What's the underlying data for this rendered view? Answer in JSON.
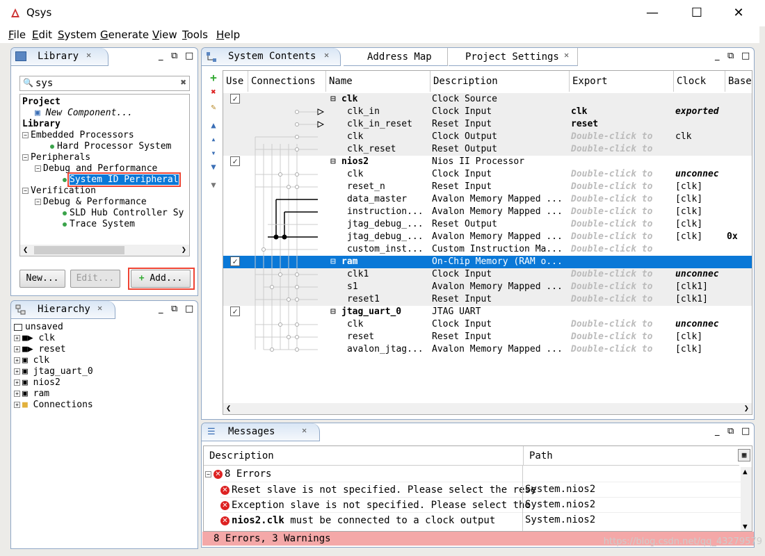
{
  "app": {
    "title": "Qsys"
  },
  "menu": [
    "File",
    "Edit",
    "System",
    "Generate",
    "View",
    "Tools",
    "Help"
  ],
  "library": {
    "tab": "Library",
    "search_value": "sys",
    "tree": [
      {
        "label": "Project",
        "bold": true,
        "indent": 0
      },
      {
        "label": "New Component...",
        "italic": true,
        "indent": 1,
        "icon": "component-icon"
      },
      {
        "label": "Library",
        "bold": true,
        "indent": 0
      },
      {
        "label": "Embedded Processors",
        "indent": 0,
        "expander": "−"
      },
      {
        "label": "Hard Processor System",
        "indent": 2,
        "dot": true
      },
      {
        "label": "Peripherals",
        "indent": 0,
        "expander": "−"
      },
      {
        "label": "Debug and Performance",
        "indent": 1,
        "expander": "−"
      },
      {
        "label": "System ID Peripheral",
        "indent": 3,
        "dot": true,
        "selected": true
      },
      {
        "label": "Verification",
        "indent": 0,
        "expander": "−"
      },
      {
        "label": "Debug & Performance",
        "indent": 1,
        "expander": "−"
      },
      {
        "label": "SLD Hub Controller Sy",
        "indent": 3,
        "dot": true
      },
      {
        "label": "Trace System",
        "indent": 3,
        "dot": true
      }
    ],
    "buttons": {
      "new": "New...",
      "edit": "Edit...",
      "add": "Add..."
    }
  },
  "hierarchy": {
    "tab": "Hierarchy",
    "root": "unsaved",
    "items": [
      "clk",
      "reset",
      "clk",
      "jtag_uart_0",
      "nios2",
      "ram",
      "Connections"
    ]
  },
  "tabs": {
    "system_contents": "System Contents",
    "address_map": "Address Map",
    "project_settings": "Project Settings"
  },
  "columns": {
    "use": "Use",
    "connections": "Connections",
    "name": "Name",
    "description": "Description",
    "export": "Export",
    "clock": "Clock",
    "base": "Base"
  },
  "rows": [
    {
      "use": true,
      "name": "clk",
      "bold": true,
      "desc": "Clock Source",
      "export": "",
      "clock": "",
      "group": "gray"
    },
    {
      "name": "clk_in",
      "desc": "Clock Input",
      "export": "clk",
      "export_bold": true,
      "clock": "exported",
      "clock_style": "bi",
      "group": "gray"
    },
    {
      "name": "clk_in_reset",
      "desc": "Reset Input",
      "export": "reset",
      "export_bold": true,
      "clock": "",
      "group": "gray"
    },
    {
      "name": "clk",
      "desc": "Clock Output",
      "export": "Double-click to",
      "clock": "clk",
      "group": "gray"
    },
    {
      "name": "clk_reset",
      "desc": "Reset Output",
      "export": "Double-click to",
      "clock": "",
      "group": "gray"
    },
    {
      "use": true,
      "name": "nios2",
      "bold": true,
      "desc": "Nios II Processor",
      "export": "",
      "clock": "",
      "group": "white"
    },
    {
      "name": "clk",
      "desc": "Clock Input",
      "export": "Double-click to",
      "clock": "unconnec",
      "clock_style": "bi",
      "group": "white"
    },
    {
      "name": "reset_n",
      "desc": "Reset Input",
      "export": "Double-click to",
      "clock": "[clk]",
      "group": "white"
    },
    {
      "name": "data_master",
      "desc": "Avalon Memory Mapped ...",
      "export": "Double-click to",
      "clock": "[clk]",
      "group": "white"
    },
    {
      "name": "instruction...",
      "desc": "Avalon Memory Mapped ...",
      "export": "Double-click to",
      "clock": "[clk]",
      "group": "white"
    },
    {
      "name": "jtag_debug_...",
      "desc": "Reset Output",
      "export": "Double-click to",
      "clock": "[clk]",
      "group": "white"
    },
    {
      "name": "jtag_debug_...",
      "desc": "Avalon Memory Mapped ...",
      "export": "Double-click to",
      "clock": "[clk]",
      "base": "0x",
      "group": "white"
    },
    {
      "name": "custom_inst...",
      "desc": "Custom Instruction Ma...",
      "export": "Double-click to",
      "clock": "",
      "group": "white"
    },
    {
      "use": true,
      "name": "ram",
      "bold": true,
      "desc": "On-Chip Memory (RAM o...",
      "export": "",
      "clock": "",
      "group": "sel"
    },
    {
      "name": "clk1",
      "desc": "Clock Input",
      "export": "Double-click to",
      "clock": "unconnec",
      "clock_style": "bi",
      "group": "gray"
    },
    {
      "name": "s1",
      "desc": "Avalon Memory Mapped ...",
      "export": "Double-click to",
      "clock": "[clk1]",
      "group": "gray"
    },
    {
      "name": "reset1",
      "desc": "Reset Input",
      "export": "Double-click to",
      "clock": "[clk1]",
      "group": "gray"
    },
    {
      "use": true,
      "name": "jtag_uart_0",
      "bold": true,
      "desc": "JTAG UART",
      "export": "",
      "clock": "",
      "group": "white"
    },
    {
      "name": "clk",
      "desc": "Clock Input",
      "export": "Double-click to",
      "clock": "unconnec",
      "clock_style": "bi",
      "group": "white"
    },
    {
      "name": "reset",
      "desc": "Reset Input",
      "export": "Double-click to",
      "clock": "[clk]",
      "group": "white"
    },
    {
      "name": "avalon_jtag...",
      "desc": "Avalon Memory Mapped ...",
      "export": "Double-click to",
      "clock": "[clk]",
      "group": "white"
    }
  ],
  "messages": {
    "tab": "Messages",
    "col_description": "Description",
    "col_path": "Path",
    "summary": "8 Errors",
    "items": [
      {
        "text": "Reset slave is not specified. Please select the rese",
        "path": "System.nios2"
      },
      {
        "text": "Exception slave is not specified. Please select the",
        "path": "System.nios2"
      },
      {
        "bold_part": "nios2.clk",
        "text": " must be connected to a clock output",
        "path": "System.nios2"
      }
    ],
    "status": "8 Errors, 3 Warnings"
  },
  "watermark": "https://blog.csdn.net/qq_43279579"
}
